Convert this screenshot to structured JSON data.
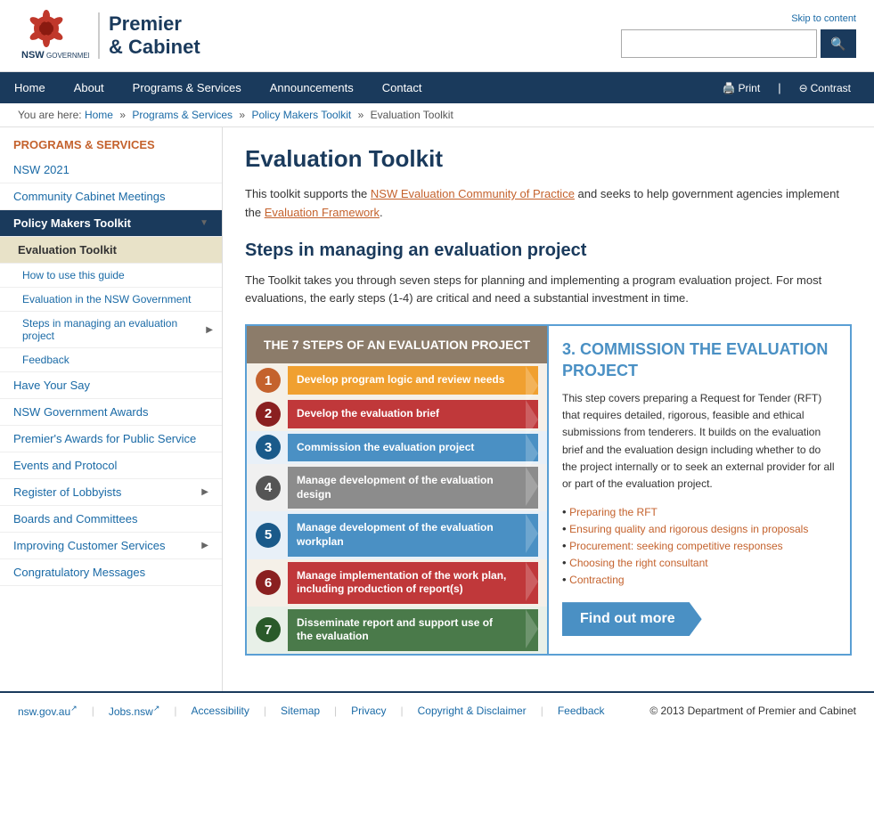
{
  "header": {
    "skip_link": "Skip to content",
    "logo_line1": "Premier",
    "logo_line2": "& Cabinet",
    "search_placeholder": "",
    "search_btn_icon": "🔍"
  },
  "nav": {
    "items": [
      "Home",
      "About",
      "Programs & Services",
      "Announcements",
      "Contact"
    ],
    "print_label": "Print",
    "contrast_label": "Contrast"
  },
  "breadcrumb": {
    "items": [
      "Home",
      "Programs & Services",
      "Policy Makers Toolkit",
      "Evaluation Toolkit"
    ]
  },
  "sidebar": {
    "section_title": "PROGRAMS & SERVICES",
    "top_links": [
      "NSW 2021",
      "Community Cabinet Meetings"
    ],
    "active_parent": "Policy Makers Toolkit",
    "active_page": "Evaluation Toolkit",
    "sub_links": [
      {
        "label": "How to use this guide",
        "has_arrow": false
      },
      {
        "label": "Evaluation in the NSW Government",
        "has_arrow": false
      },
      {
        "label": "Steps in managing an evaluation project",
        "has_arrow": true
      },
      {
        "label": "Feedback",
        "has_arrow": false
      }
    ],
    "bottom_links": [
      {
        "label": "Have Your Say",
        "has_arrow": false
      },
      {
        "label": "NSW Government Awards",
        "has_arrow": false
      },
      {
        "label": "Premier's Awards for Public Service",
        "has_arrow": false
      },
      {
        "label": "Events and Protocol",
        "has_arrow": false
      },
      {
        "label": "Register of Lobbyists",
        "has_arrow": true
      },
      {
        "label": "Boards and Committees",
        "has_arrow": false
      },
      {
        "label": "Improving Customer Services",
        "has_arrow": true
      },
      {
        "label": "Congratulatory Messages",
        "has_arrow": false
      }
    ]
  },
  "main": {
    "page_title": "Evaluation Toolkit",
    "intro": "This toolkit supports the NSW Evaluation Community of Practice and seeks to help government agencies implement the Evaluation Framework.",
    "steps_heading": "Steps in managing an evaluation project",
    "steps_body": "The Toolkit takes you through seven steps for planning and implementing a program evaluation project. For most evaluations, the early steps (1-4) are critical and need a substantial investment in time.",
    "diagram_header": "THE 7 STEPS OF AN EVALUATION PROJECT",
    "steps": [
      {
        "num": "1",
        "label": "Develop program logic and review needs"
      },
      {
        "num": "2",
        "label": "Develop the evaluation brief"
      },
      {
        "num": "3",
        "label": "Commission the evaluation project"
      },
      {
        "num": "4",
        "label": "Manage development of the evaluation design"
      },
      {
        "num": "5",
        "label": "Manage development of the evaluation workplan"
      },
      {
        "num": "6",
        "label": "Manage implementation of the work plan, including production of report(s)"
      },
      {
        "num": "7",
        "label": "Disseminate report and support use of the evaluation"
      }
    ],
    "commission_title": "3. COMMISSION THE EVALUATION PROJECT",
    "commission_desc": "This step covers preparing a Request for Tender (RFT) that requires detailed, rigorous, feasible and ethical submissions from tenderers. It builds on the evaluation brief and the evaluation design including whether to do the project internally or to seek an external provider for all or part of the evaluation project.",
    "commission_links": [
      "Preparing the RFT",
      "Ensuring quality and rigorous designs in proposals",
      "Procurement: seeking competitive responses",
      "Choosing the right consultant",
      "Contracting"
    ],
    "find_out_more": "Find out more"
  },
  "footer": {
    "links": [
      "nsw.gov.au",
      "Jobs.nsw",
      "Accessibility",
      "Sitemap",
      "Privacy",
      "Copyright & Disclaimer",
      "Feedback"
    ],
    "copyright": "© 2013 Department of Premier and Cabinet"
  }
}
